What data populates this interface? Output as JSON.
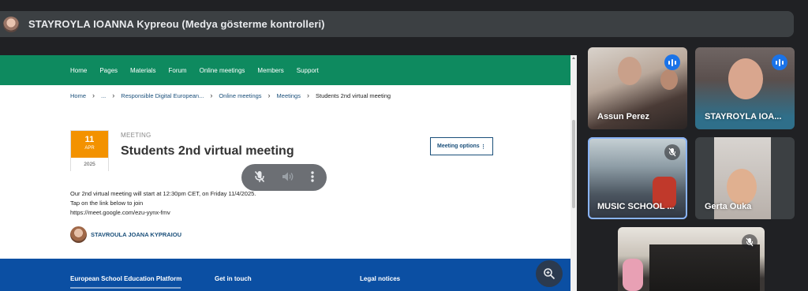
{
  "presenter_bar": {
    "title": "STAYROYLA IOANNA Kypreou (Medya gösterme kontrolleri)"
  },
  "shared_page": {
    "nav": [
      "Home",
      "Pages",
      "Materials",
      "Forum",
      "Online meetings",
      "Members",
      "Support"
    ],
    "breadcrumb": [
      "Home",
      "...",
      "Responsible Digital European...",
      "Online meetings",
      "Meetings",
      "Students 2nd virtual meeting"
    ],
    "date": {
      "day": "11",
      "month": "APR",
      "year": "2025"
    },
    "kicker": "MEETING",
    "title": "Students 2nd virtual meeting",
    "options_label": "Meeting options",
    "description": [
      "Our 2nd virtual meeting will start at 12:30pm CET, on Friday 11/4/2025.",
      "Tap on the link below to join",
      "https://meet.google.com/ezu-yynx-fmv"
    ],
    "author": "STAVROULA JOANA KYPRAIOU",
    "footer": {
      "col1": "European School Education Platform",
      "col2": "Get in touch",
      "col3": "Legal notices"
    }
  },
  "media_controls": {
    "icons": [
      "mic-off-icon",
      "volume-icon",
      "more-vert-icon"
    ]
  },
  "participants": [
    {
      "name": "Assun Perez",
      "state": "speaking"
    },
    {
      "name": "STAYROYLA IOA...",
      "state": "speaking"
    },
    {
      "name": "MUSIC SCHOOL ...",
      "state": "muted"
    },
    {
      "name": "Gerta Ouka",
      "state": "none"
    },
    {
      "name": "",
      "state": "muted"
    }
  ],
  "colors": {
    "meet_bg": "#202124",
    "nav_green": "#0e8a5f",
    "footer_blue": "#0b4fa3",
    "date_orange": "#f39200",
    "speaking_blue": "#1a73e8"
  }
}
